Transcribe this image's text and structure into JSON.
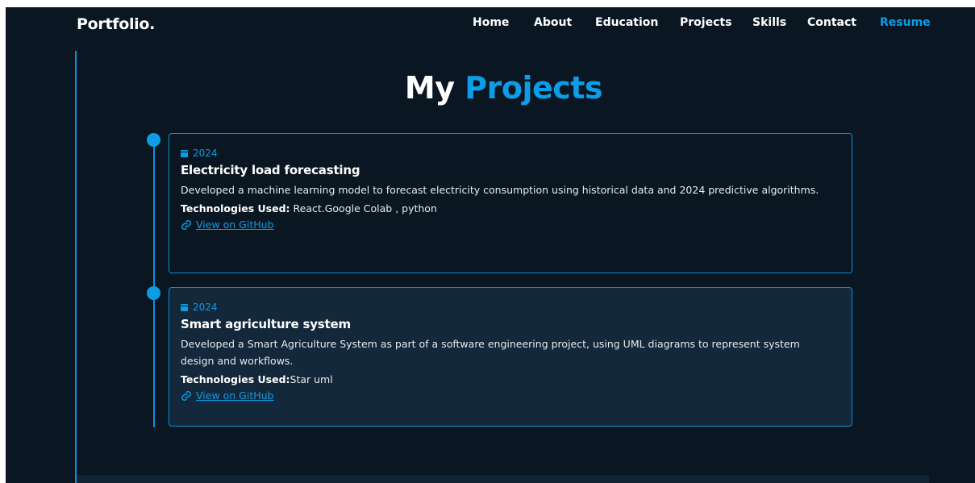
{
  "brand": "Portfolio.",
  "nav": {
    "home": "Home",
    "about": "About",
    "education": "Education",
    "projects": "Projects",
    "skills": "Skills",
    "contact": "Contact",
    "resume": "Resume"
  },
  "heading": {
    "word1": "My",
    "word2": "Projects"
  },
  "projects": [
    {
      "date": "2024",
      "title": "Electricity load forecasting",
      "description": "Developed a machine learning model to forecast electricity consumption using historical data and 2024 predictive algorithms.",
      "tech_label": "Technologies Used:",
      "tech_value": " React.Google Colab , python",
      "link": "View on GitHub"
    },
    {
      "date": "2024",
      "title": "Smart agriculture system",
      "description": "Developed a Smart Agriculture System as part of a software engineering project, using UML diagrams to represent system design and workflows.",
      "tech_label": "Technologies Used:",
      "tech_value": "Star uml",
      "link": "View on GitHub"
    }
  ],
  "colors": {
    "background": "#0a1722",
    "accent": "#0d9ce6",
    "card_alt": "#13283a"
  }
}
